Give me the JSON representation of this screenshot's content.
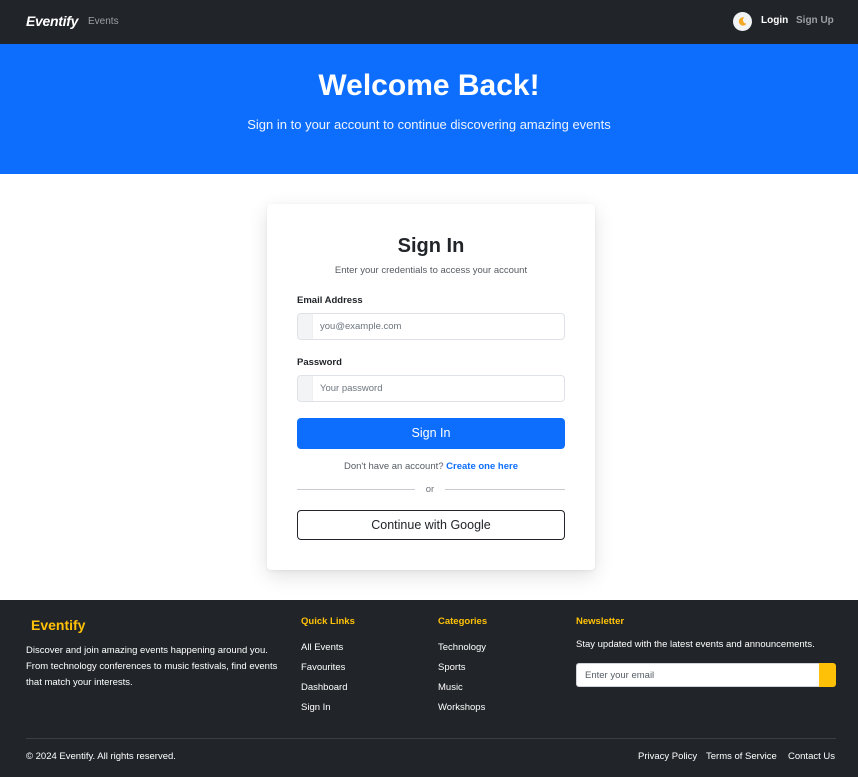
{
  "navbar": {
    "brand": "Eventify",
    "events_link": "Events",
    "login_link": "Login",
    "signup_link": "Sign Up",
    "theme_icon": "moon-icon"
  },
  "hero": {
    "title": "Welcome Back!",
    "subtitle": "Sign in to your account to continue discovering amazing events"
  },
  "signin": {
    "title": "Sign In",
    "subtitle": "Enter your credentials to access your account",
    "email_label": "Email Address",
    "email_placeholder": "you@example.com",
    "password_label": "Password",
    "password_placeholder": "Your password",
    "submit_label": "Sign In",
    "no_account_text": "Don't have an account?",
    "create_link": "Create one here",
    "divider_text": "or",
    "google_label": "Continue with Google"
  },
  "footer": {
    "brand": "Eventify",
    "description": "Discover and join amazing events happening around you. From technology conferences to music festivals, find events that match your interests.",
    "quick_links": {
      "heading": "Quick Links",
      "items": [
        "All Events",
        "Favourites",
        "Dashboard",
        "Sign In"
      ]
    },
    "categories": {
      "heading": "Categories",
      "items": [
        "Technology",
        "Sports",
        "Music",
        "Workshops"
      ]
    },
    "newsletter": {
      "heading": "Newsletter",
      "text": "Stay updated with the latest events and announcements.",
      "placeholder": "Enter your email"
    },
    "copyright": "© 2024 Eventify. All rights reserved.",
    "legal": {
      "privacy": "Privacy Policy",
      "terms": "Terms of Service",
      "contact": "Contact Us"
    }
  },
  "colors": {
    "primary": "#0d6efd",
    "dark": "#212529",
    "accent": "#ffc107"
  }
}
